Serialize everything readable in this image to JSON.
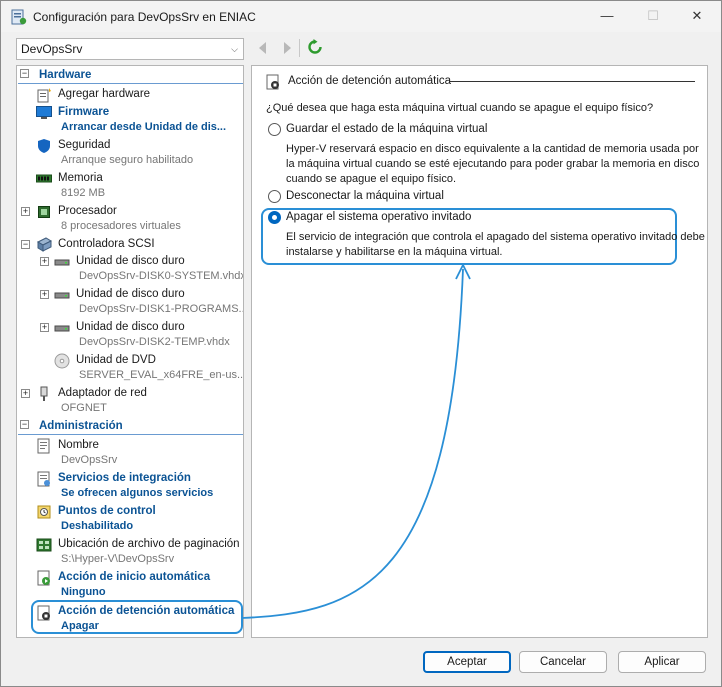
{
  "window": {
    "title": "Configuración para DevOpsSrv en ENIAC",
    "minimize": "—",
    "maximize": "☐",
    "close": "✕"
  },
  "toolbar": {
    "vm_selected": "DevOpsSrv"
  },
  "sidebar": {
    "hardware_header": "Hardware",
    "admin_header": "Administración",
    "hardware_items": [
      {
        "label": "Agregar hardware",
        "sub": ""
      },
      {
        "label": "Firmware",
        "sub": "Arrancar desde Unidad de dis..."
      },
      {
        "label": "Seguridad",
        "sub": "Arranque seguro habilitado"
      },
      {
        "label": "Memoria",
        "sub": "8192 MB"
      },
      {
        "label": "Procesador",
        "sub": "8 procesadores virtuales"
      },
      {
        "label": "Controladora SCSI",
        "sub": ""
      },
      {
        "label": "Unidad de disco duro",
        "sub": "DevOpsSrv-DISK0-SYSTEM.vhdx"
      },
      {
        "label": "Unidad de disco duro",
        "sub": "DevOpsSrv-DISK1-PROGRAMS..."
      },
      {
        "label": "Unidad de disco duro",
        "sub": "DevOpsSrv-DISK2-TEMP.vhdx"
      },
      {
        "label": "Unidad de DVD",
        "sub": "SERVER_EVAL_x64FRE_en-us...."
      },
      {
        "label": "Adaptador de red",
        "sub": "OFGNET"
      }
    ],
    "admin_items": [
      {
        "label": "Nombre",
        "sub": "DevOpsSrv"
      },
      {
        "label": "Servicios de integración",
        "sub": "Se ofrecen algunos servicios"
      },
      {
        "label": "Puntos de control",
        "sub": "Deshabilitado"
      },
      {
        "label": "Ubicación de archivo de paginación ...",
        "sub": "S:\\Hyper-V\\DevOpsSrv"
      },
      {
        "label": "Acción de inicio automática",
        "sub": "Ninguno"
      },
      {
        "label": "Acción de detención automática",
        "sub": "Apagar"
      }
    ]
  },
  "panel": {
    "heading": "Acción de detención automática",
    "question": "¿Qué desea que haga esta máquina virtual cuando se apague el equipo físico?",
    "options": [
      {
        "label": "Guardar el estado de la máquina virtual",
        "desc": "Hyper-V reservará espacio en disco equivalente a la cantidad de memoria usada por la máquina virtual cuando se esté ejecutando para poder grabar la memoria en disco cuando se apague el equipo físico.",
        "selected": false
      },
      {
        "label": "Desconectar la máquina virtual",
        "desc": "",
        "selected": false
      },
      {
        "label": "Apagar el sistema operativo invitado",
        "desc": "El servicio de integración que controla el apagado del sistema operativo invitado debe instalarse y habilitarse en la máquina virtual.",
        "selected": true
      }
    ]
  },
  "buttons": {
    "accept": "Aceptar",
    "cancel": "Cancelar",
    "apply": "Aplicar"
  },
  "colors": {
    "accent": "#0067c0",
    "link": "#0b5394",
    "highlight": "#2a8fd6"
  }
}
